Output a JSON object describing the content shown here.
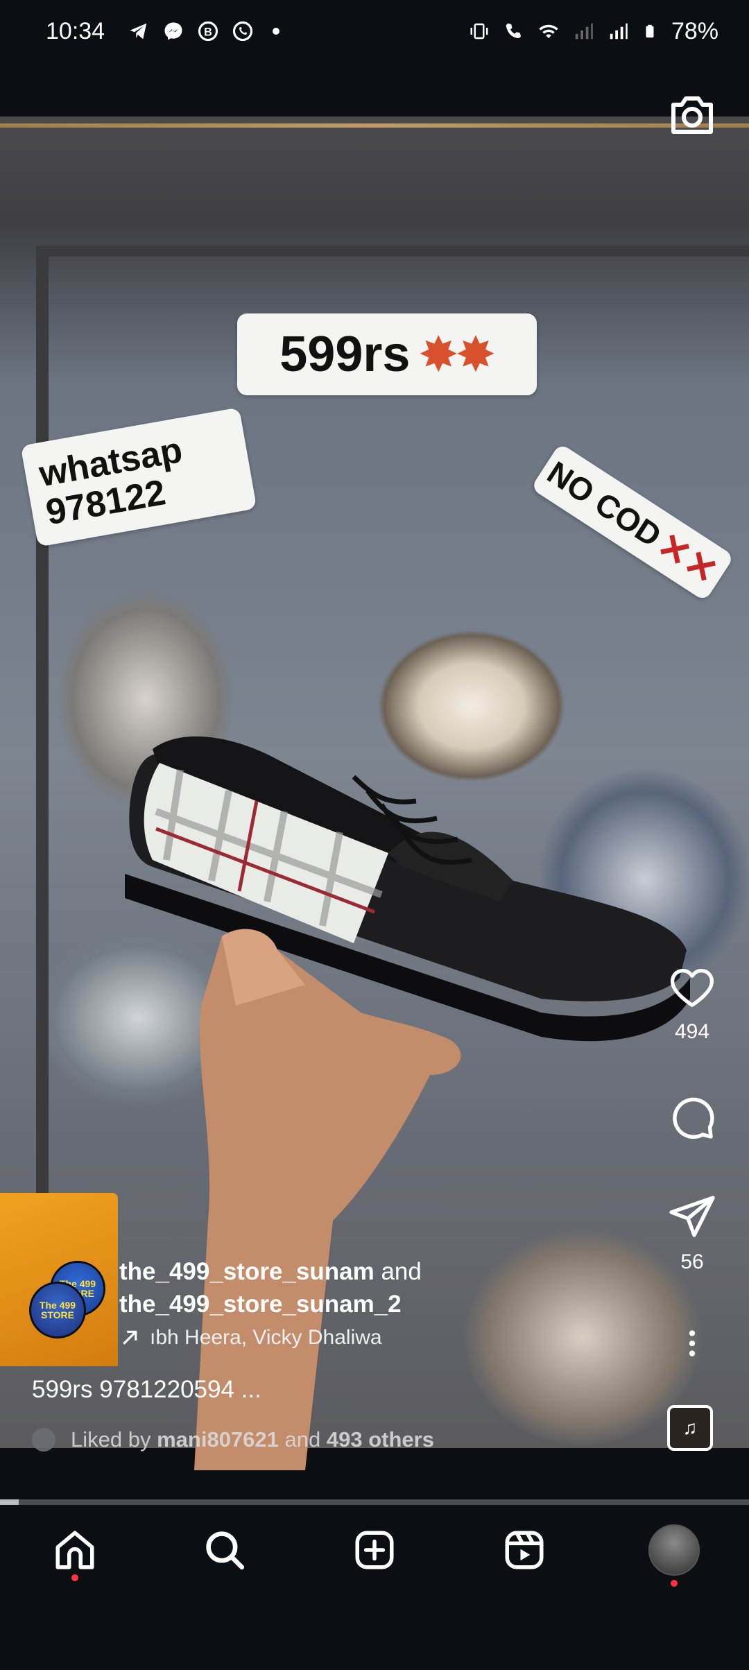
{
  "status_bar": {
    "time": "10:34",
    "battery": "78%",
    "left_icons": [
      "telegram-icon",
      "messenger-icon",
      "b-icon",
      "whatsapp-icon",
      "dot-icon"
    ],
    "right_icons": [
      "vibrate-icon",
      "wifi-call-icon",
      "wifi-icon",
      "signal-icon",
      "signal-icon",
      "battery-icon"
    ]
  },
  "video": {
    "stickers": {
      "price": "599rs",
      "whatsapp": "whatsap 978122",
      "no_cod": "NO COD"
    }
  },
  "rail": {
    "likes_count": "494",
    "shares_count": "56"
  },
  "post": {
    "owner_primary": "the_499_store_sunam",
    "and_word": "and",
    "owner_secondary": "the_499_store_sunam_2",
    "audio": "ıbh Heera, Vicky Dhaliwa",
    "caption": "599rs 9781220594 ...",
    "liked_prefix": "Liked by",
    "liked_user": "mani807621",
    "liked_and": "and",
    "liked_others": "493 others",
    "avatar_text": "The 499 STORE"
  },
  "progress": {
    "value_fraction": 0.025
  },
  "nav": {
    "items": [
      "home-icon",
      "search-icon",
      "create-icon",
      "reels-icon",
      "profile-avatar"
    ]
  },
  "colors": {
    "background": "#0b0f14",
    "notification_dot": "#ff3040",
    "burst": "#d8512c",
    "no_cod_x": "#c62626"
  }
}
